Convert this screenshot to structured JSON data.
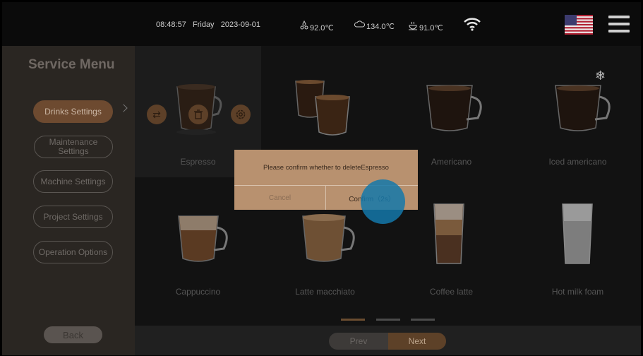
{
  "status": {
    "time": "08:48:57",
    "day": "Friday",
    "date": "2023-09-01",
    "temp1": "92.0℃",
    "temp2": "134.0℃",
    "temp3": "91.0℃",
    "icons": [
      "water-drops-icon",
      "steam-cloud-icon",
      "hot-cup-icon",
      "wifi-icon",
      "us-flag-icon",
      "hamburger-menu-icon"
    ]
  },
  "sidebar": {
    "title": "Service Menu",
    "items": [
      {
        "label": "Drinks Settings"
      },
      {
        "label": "Maintenance Settings"
      },
      {
        "label": "Machine Settings"
      },
      {
        "label": "Project Settings"
      },
      {
        "label": "Operation Options"
      }
    ],
    "back": "Back"
  },
  "drinks": [
    {
      "name": "Espresso"
    },
    {
      "name": ""
    },
    {
      "name": "Americano"
    },
    {
      "name": "Iced americano"
    },
    {
      "name": "Cappuccino"
    },
    {
      "name": "Latte macchiato"
    },
    {
      "name": "Coffee latte"
    },
    {
      "name": "Hot milk foam"
    }
  ],
  "dialog": {
    "message": "Please confirm whether to deleteEspresso",
    "cancel": "Cancel",
    "confirm": "Confirm（2s）"
  },
  "pager": {
    "prev": "Prev",
    "next": "Next",
    "pages": 3,
    "current": 1
  },
  "colors": {
    "accent": "#6d4a30",
    "dialog": "#b8916f",
    "touch": "#1478aa"
  }
}
